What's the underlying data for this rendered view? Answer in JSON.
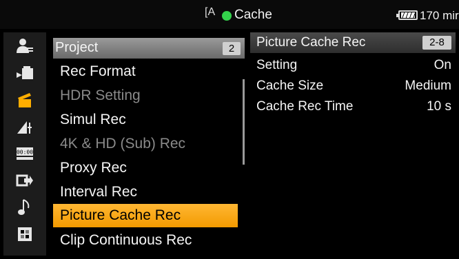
{
  "status": {
    "mode_icon": "[A",
    "title": "Cache",
    "remaining": "170 mir",
    "colors": {
      "record_dot": "#33d14b",
      "accent": "#f39a00"
    }
  },
  "sidebar": {
    "icons": [
      {
        "name": "user-settings-icon",
        "glyph": "♟",
        "active": false
      },
      {
        "name": "camera-icon",
        "glyph": "▶",
        "active": false
      },
      {
        "name": "clapperboard-icon",
        "glyph": "▰",
        "active": true
      },
      {
        "name": "tc-media-icon",
        "glyph": "◩",
        "active": false
      },
      {
        "name": "timecode-icon",
        "glyph": "00:00",
        "active": false
      },
      {
        "name": "output-icon",
        "glyph": "⇨",
        "active": false
      },
      {
        "name": "audio-icon",
        "glyph": "♪",
        "active": false
      },
      {
        "name": "system-icon",
        "glyph": "▦",
        "active": false
      }
    ]
  },
  "menu": {
    "header": {
      "label": "Project",
      "page": "2"
    },
    "items": [
      {
        "label": "Rec Format",
        "state": "normal"
      },
      {
        "label": "HDR Setting",
        "state": "disabled"
      },
      {
        "label": "Simul Rec",
        "state": "normal"
      },
      {
        "label": "4K & HD (Sub) Rec",
        "state": "disabled"
      },
      {
        "label": "Proxy Rec",
        "state": "normal"
      },
      {
        "label": "Interval Rec",
        "state": "normal"
      },
      {
        "label": "Picture Cache Rec",
        "state": "selected"
      },
      {
        "label": "Clip Continuous Rec",
        "state": "normal"
      }
    ]
  },
  "detail": {
    "header": {
      "label": "Picture Cache Rec",
      "page": "2-8"
    },
    "rows": [
      {
        "key": "Setting",
        "value": "On"
      },
      {
        "key": "Cache Size",
        "value": "Medium"
      },
      {
        "key": "Cache Rec Time",
        "value": "10 s"
      }
    ]
  }
}
